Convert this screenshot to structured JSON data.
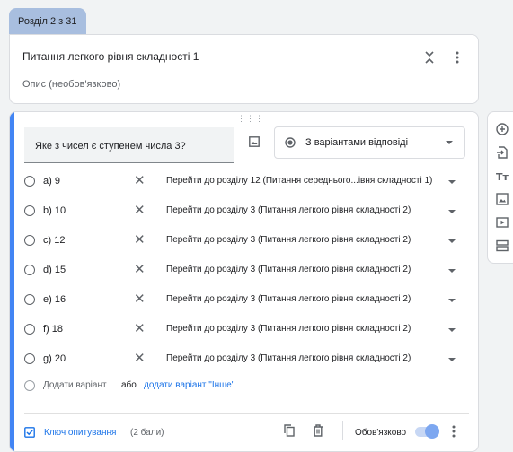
{
  "section": {
    "tab_label": "Розділ 2 з 31",
    "title": "Питання легкого рівня складності 1",
    "description_placeholder": "Опис (необов'язково)"
  },
  "question": {
    "text": "Яке з чисел є ступенем числа 3?",
    "type_label": "З варіантами відповіді",
    "options": [
      {
        "label": "a) 9",
        "goto": "Перейти до розділу 12 (Питання середнього...івня складності 1)"
      },
      {
        "label": "b) 10",
        "goto": "Перейти до розділу 3 (Питання легкого рівня складності 2)"
      },
      {
        "label": "c) 12",
        "goto": "Перейти до розділу 3 (Питання легкого рівня складності 2)"
      },
      {
        "label": "d) 15",
        "goto": "Перейти до розділу 3 (Питання легкого рівня складності 2)"
      },
      {
        "label": "e) 16",
        "goto": "Перейти до розділу 3 (Питання легкого рівня складності 2)"
      },
      {
        "label": "f) 18",
        "goto": "Перейти до розділу 3 (Питання легкого рівня складності 2)"
      },
      {
        "label": "g) 20",
        "goto": "Перейти до розділу 3 (Питання легкого рівня складності 2)"
      }
    ],
    "add_option": "Додати варіант",
    "add_or": "або",
    "add_other": "додати варіант \"Інше\""
  },
  "footer": {
    "answer_key": "Ключ опитування",
    "points": "(2 бали)",
    "required": "Обов'язково",
    "required_on": true
  },
  "colors": {
    "accent": "#1a73e8",
    "left_bar": "#4285f4",
    "section_tab": "#a8bedf"
  },
  "toolbar": [
    "add-question-icon",
    "import-questions-icon",
    "add-title-icon",
    "add-image-icon",
    "add-video-icon",
    "add-section-icon"
  ]
}
